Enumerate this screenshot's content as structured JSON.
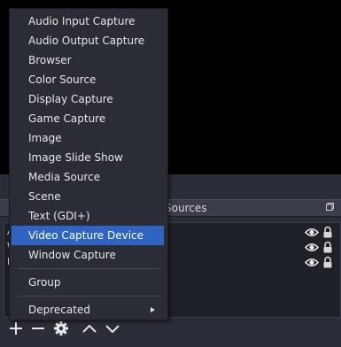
{
  "sources_panel": {
    "title": "Sources",
    "rows": [
      {
        "first_char": "A"
      },
      {
        "first_char": "W"
      },
      {
        "first_char": "D"
      }
    ]
  },
  "toolbar": {
    "add_icon": "plus-icon",
    "remove_icon": "minus-icon",
    "properties_icon": "gear-icon",
    "move_up_icon": "chevron-up-icon",
    "move_down_icon": "chevron-down-icon"
  },
  "context_menu": {
    "items": [
      {
        "label": "Audio Input Capture"
      },
      {
        "label": "Audio Output Capture"
      },
      {
        "label": "Browser"
      },
      {
        "label": "Color Source"
      },
      {
        "label": "Display Capture"
      },
      {
        "label": "Game Capture"
      },
      {
        "label": "Image"
      },
      {
        "label": "Image Slide Show"
      },
      {
        "label": "Media Source"
      },
      {
        "label": "Scene"
      },
      {
        "label": "Text (GDI+)"
      },
      {
        "label": "Video Capture Device",
        "highlighted": true
      },
      {
        "label": "Window Capture"
      }
    ],
    "group_label": "Group",
    "deprecated_label": "Deprecated"
  },
  "colors": {
    "menu_background": "#2a2c36",
    "highlight": "#2f64c2",
    "panel_background": "#2b2e38"
  }
}
